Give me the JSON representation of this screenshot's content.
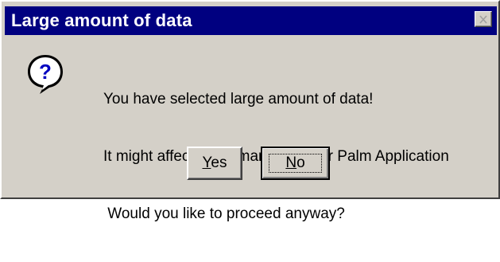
{
  "dialog": {
    "title": "Large amount of data",
    "close_icon": "close-icon",
    "message_icon": "question-icon",
    "message_lines": [
      "You have selected large amount of data!",
      "It might affect performance of your Palm Application",
      " Would you like to proceed anyway?"
    ],
    "buttons": {
      "yes": {
        "mnemonic": "Y",
        "rest": "es"
      },
      "no": {
        "mnemonic": "N",
        "rest": "o"
      }
    },
    "default_button": "no"
  },
  "colors": {
    "title_bar": "#000080",
    "title_text": "#ffffff",
    "face": "#d4d0c8",
    "icon_fill": "#ffffff",
    "icon_glyph": "#0000c0"
  }
}
